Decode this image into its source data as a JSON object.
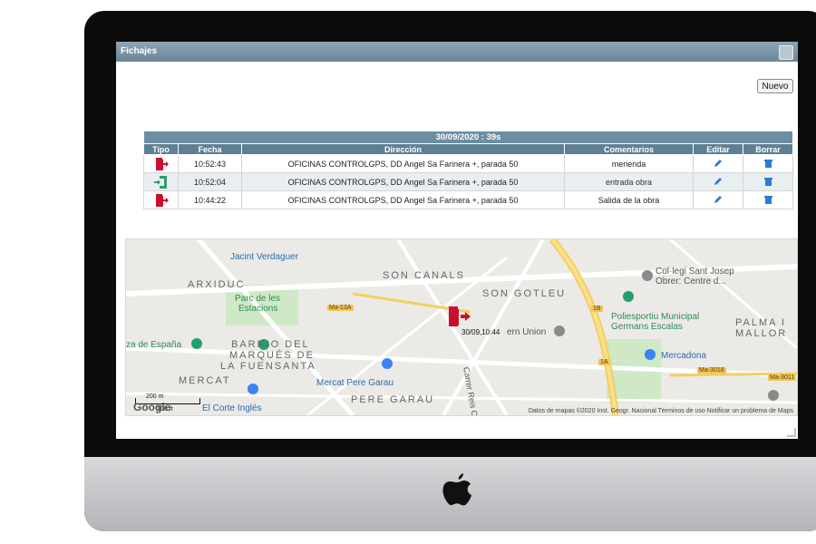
{
  "window": {
    "title": "Fichajes"
  },
  "toolbar": {
    "new_label": "Nuevo"
  },
  "table": {
    "caption": "30/09/2020 : 39s",
    "columns": [
      "Tipo",
      "Fecha",
      "Dirección",
      "Comentarios",
      "Editar",
      "Borrar"
    ],
    "rows": [
      {
        "type": "exit-icon",
        "time": "10:52:43",
        "address": "OFICINAS CONTROLGPS, DD Angel Sa Farinera +, parada 50",
        "comment": "merienda"
      },
      {
        "type": "entry-icon",
        "time": "10:52:04",
        "address": "OFICINAS CONTROLGPS, DD Angel Sa Farinera +, parada 50",
        "comment": "entrada obra"
      },
      {
        "type": "exit-icon",
        "time": "10:44:22",
        "address": "OFICINAS CONTROLGPS, DD Angel Sa Farinera +, parada 50",
        "comment": "Salida de la obra"
      }
    ]
  },
  "map": {
    "labels": {
      "jacint": "Jacint Verdaguer",
      "son_canals": "SON CANALS",
      "arxiduc": "ARXIDUC",
      "son_gotleu": "SON GOTLEU",
      "parc": "Parc de les",
      "estacions": "Estacions",
      "barrio1": "BARRIO DEL",
      "barrio2": "MARQUÉS DE",
      "barrio3": "LA FUENSANTA",
      "espana": "za de España",
      "mercat": "MERCAT",
      "mercat_pere": "Mercat Pere Garau",
      "pere_garau": "PERE GARAU",
      "corte": "El Corte Inglés",
      "collegi1": "Col·legi Sant Josep",
      "collegi2": "Obrer: Centre d...",
      "poli1": "Poliesportiu Municipal",
      "poli2": "Germans Escalas",
      "palma1": "PALMA I",
      "palma2": "MALLOR",
      "mercadona": "Mercadona",
      "union": "ern Union",
      "carrer_reis": "Carrer Reis C"
    },
    "road_tags": {
      "ma13a": "Ma-13A",
      "r1b": "1B",
      "r1a": "1A",
      "ma3018": "Ma-3018",
      "ma3011": "Ma-3011"
    },
    "marker_label": "30/09,10:44",
    "scale_200m": "200 m",
    "scale_100ft": "100 ft",
    "attribution": "Datos de mapas ©2020 Inst. Geogr. Nacional    Términos de uso    Notificar un problema de Maps",
    "google": "Google"
  },
  "colors": {
    "titlebar": "#7b93a5",
    "table_header": "#5f8094",
    "exit_icon": "#c8102e",
    "entry_icon": "#2f9e6e",
    "action_icon": "#2b7bd6"
  }
}
